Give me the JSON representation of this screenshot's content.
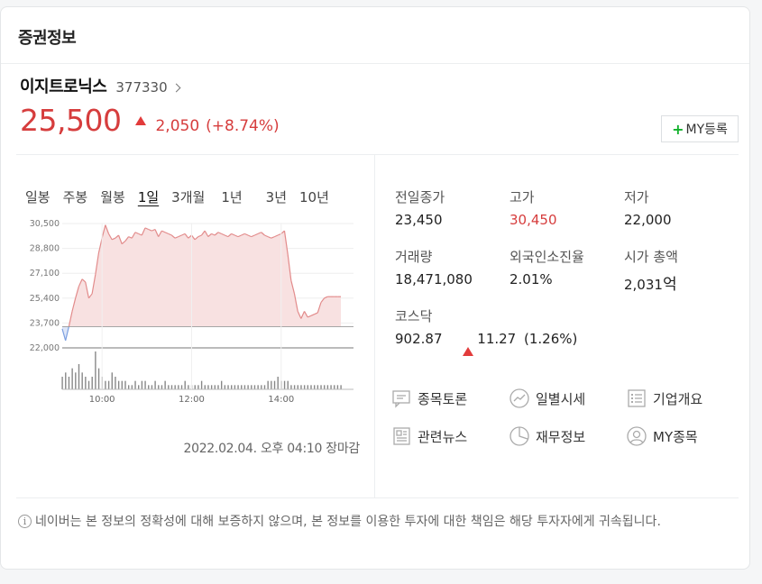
{
  "card": {
    "title": "증권정보"
  },
  "stock": {
    "name": "이지트로닉스",
    "code": "377330",
    "price": "25,500",
    "change": "2,050",
    "change_pct": "(+8.74%)",
    "direction": "up",
    "my_button_label": "MY등록"
  },
  "tabs": [
    "일봉",
    "주봉",
    "월봉",
    "1일",
    "3개월",
    "1년",
    "3년",
    "10년"
  ],
  "active_tab": "1일",
  "chart_footer": "2022.02.04. 오후 04:10 장마감",
  "chart_data": {
    "type": "area",
    "y_ticks": [
      "30,500",
      "28,800",
      "27,100",
      "25,400",
      "23,700",
      "22,000"
    ],
    "x_ticks": [
      "10:00",
      "12:00",
      "14:00"
    ],
    "ylim": [
      22000,
      30500
    ],
    "baseline": 23450,
    "colors": {
      "up_fill": "#f8e1e1",
      "up_line": "#e28b8b",
      "down_fill": "#dde6f8",
      "down_line": "#7a9ee0",
      "volume": "#888888"
    },
    "series": [
      {
        "values": [
          23300,
          22500,
          23450,
          24500,
          25400,
          26200,
          26700,
          26500,
          25400,
          25700,
          27000,
          28500,
          29500,
          30400,
          29800,
          29400,
          29500,
          29700,
          29100,
          29300,
          29600,
          29500,
          29900,
          29800,
          29700,
          30200,
          30100,
          30000,
          30100,
          29600,
          30000,
          29900,
          29800,
          29700,
          29500,
          29600,
          29700,
          29800,
          29500,
          29700,
          29400,
          29600,
          29700,
          30000,
          29600,
          29800,
          29700,
          29900,
          29800,
          29700,
          29600,
          29800,
          29700,
          29600,
          29700,
          29800,
          29700,
          29600,
          29700,
          29800,
          29900,
          29700,
          29600,
          29500,
          29600,
          29700,
          29800,
          30000,
          28400,
          26600,
          25700,
          24500,
          24000,
          24500,
          24100,
          24200,
          24300,
          24400,
          25100,
          25400,
          25500,
          25500,
          25500,
          25500,
          25500
        ]
      },
      {
        "name": "volume",
        "values": [
          3,
          4,
          3,
          5,
          4,
          6,
          4,
          3,
          2,
          3,
          9,
          5,
          3,
          2,
          2,
          4,
          3,
          2,
          2,
          2,
          1,
          1,
          2,
          1,
          2,
          2,
          1,
          1,
          2,
          1,
          1,
          2,
          1,
          1,
          1,
          1,
          1,
          2,
          1,
          1,
          1,
          1,
          2,
          1,
          1,
          1,
          1,
          1,
          2,
          1,
          1,
          1,
          1,
          1,
          1,
          1,
          1,
          1,
          1,
          1,
          1,
          1,
          2,
          2,
          2,
          3,
          2,
          2,
          2,
          1,
          1,
          1,
          1,
          1,
          1,
          1,
          1,
          1,
          1,
          1,
          1,
          1,
          1,
          1,
          1
        ]
      }
    ]
  },
  "stats": {
    "prev_close": {
      "label": "전일종가",
      "value": "23,450"
    },
    "high": {
      "label": "고가",
      "value": "30,450"
    },
    "low": {
      "label": "저가",
      "value": "22,000"
    },
    "volume": {
      "label": "거래량",
      "value": "18,471,080"
    },
    "foreign": {
      "label": "외국인소진율",
      "value": "2.01%"
    },
    "mcap": {
      "label": "시가 총액",
      "value": "2,031",
      "unit": "억"
    },
    "index": {
      "label": "코스닥",
      "value": "902.87",
      "change": "11.27",
      "change_pct": "(1.26%)"
    }
  },
  "links": {
    "discussion": {
      "label": "종목토론",
      "icon": "chat-icon"
    },
    "daily": {
      "label": "일별시세",
      "icon": "trend-icon"
    },
    "company": {
      "label": "기업개요",
      "icon": "list-icon"
    },
    "news": {
      "label": "관련뉴스",
      "icon": "news-icon"
    },
    "finance": {
      "label": "재무정보",
      "icon": "pie-icon"
    },
    "my": {
      "label": "MY종목",
      "icon": "user-icon"
    }
  },
  "footer": {
    "disclaimer": "네이버는 본 정보의 정확성에 대해 보증하지 않으며, 본 정보를 이용한 투자에 대한 책임은 해당 투자자에게 귀속됩니다."
  }
}
